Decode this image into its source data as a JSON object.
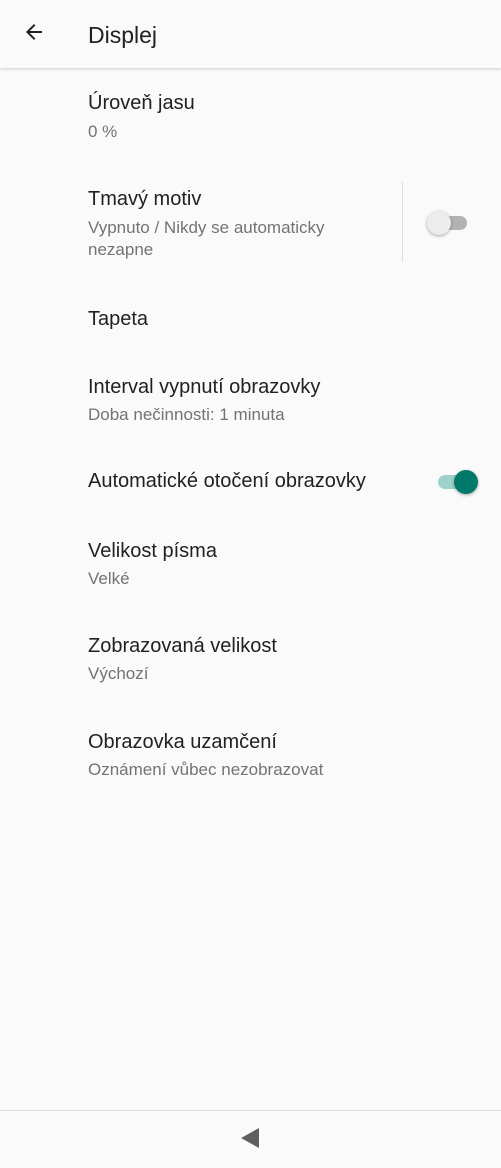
{
  "appbar": {
    "title": "Displej",
    "back_icon": "arrow-back-icon"
  },
  "settings": {
    "brightness": {
      "title": "Úroveň jasu",
      "summary": "0 %"
    },
    "dark_theme": {
      "title": "Tmavý motiv",
      "summary": "Vypnuto / Nikdy se automaticky nezapne",
      "enabled": false
    },
    "wallpaper": {
      "title": "Tapeta"
    },
    "screen_timeout": {
      "title": "Interval vypnutí obrazovky",
      "summary": "Doba nečinnosti: 1 minuta"
    },
    "auto_rotate": {
      "title": "Automatické otočení obrazovky",
      "enabled": true
    },
    "font_size": {
      "title": "Velikost písma",
      "summary": "Velké"
    },
    "display_size": {
      "title": "Zobrazovaná velikost",
      "summary": "Výchozí"
    },
    "lock_screen": {
      "title": "Obrazovka uzamčení",
      "summary": "Oznámení vůbec nezobrazovat"
    }
  },
  "navbar": {
    "back_icon": "nav-back-triangle-icon"
  },
  "colors": {
    "accent": "#00796b",
    "accent_track": "#9fd1cb",
    "background": "#fafafa",
    "primary_text": "#212121",
    "secondary_text": "#737373"
  }
}
